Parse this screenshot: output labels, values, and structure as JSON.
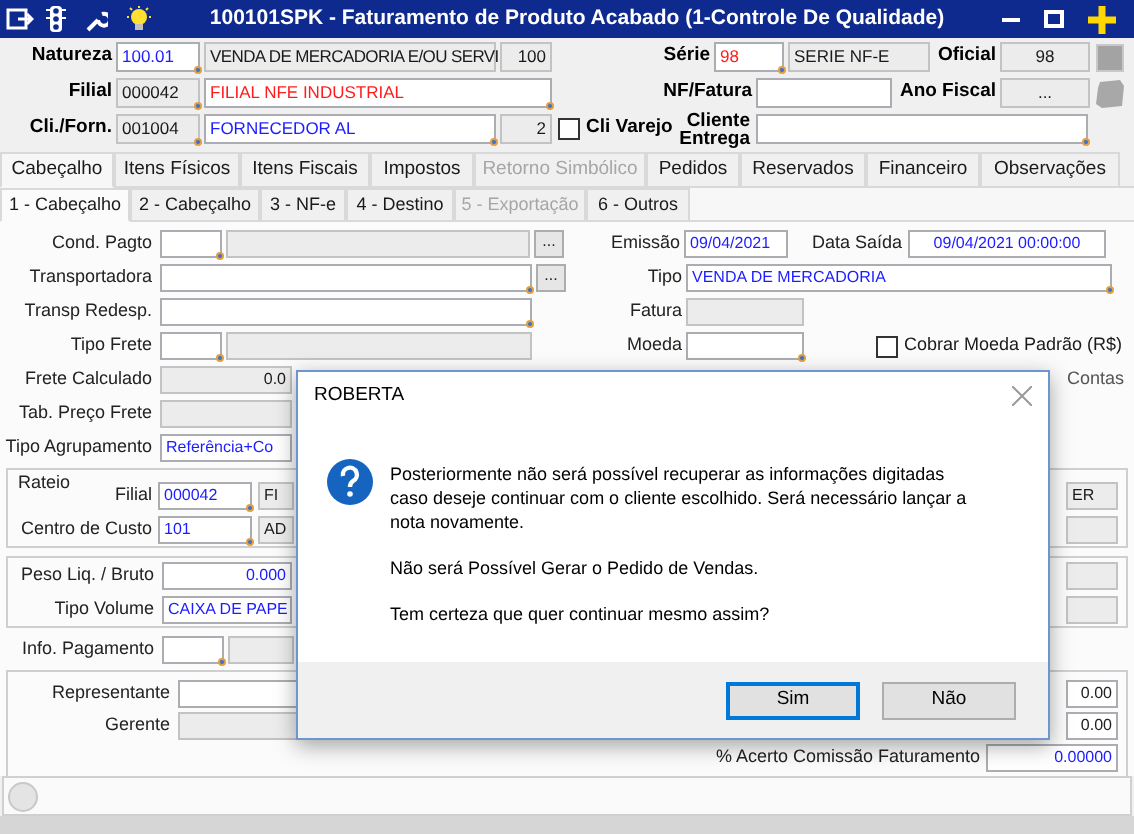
{
  "window": {
    "title": "100101SPK - Faturamento de Produto Acabado (1-Controle De Qualidade)"
  },
  "header": {
    "natureza": {
      "label": "Natureza",
      "code": "100.01",
      "description": "VENDA DE MERCADORIA E/OU SERVI",
      "number": "100"
    },
    "serie": {
      "label": "Série",
      "code": "98",
      "description": "SERIE NF-E"
    },
    "oficial": {
      "label": "Oficial",
      "value": "98"
    },
    "filial": {
      "label": "Filial",
      "code": "000042",
      "description": "FILIAL NFE INDUSTRIAL"
    },
    "nf_fatura": {
      "label": "NF/Fatura"
    },
    "ano_fiscal": {
      "label": "Ano Fiscal",
      "value": "..."
    },
    "cli_forn": {
      "label": "Cli./Forn.",
      "code": "001004",
      "description": "FORNECEDOR AL",
      "number": "2"
    },
    "cli_varejo": {
      "label": "Cli Varejo",
      "checked": false
    },
    "cliente_entrega": {
      "label": "Cliente Entrega"
    }
  },
  "tabs": [
    {
      "label": "Cabeçalho",
      "selected": true,
      "disabled": false
    },
    {
      "label": "Itens Físicos",
      "selected": false,
      "disabled": false
    },
    {
      "label": "Itens Fiscais",
      "selected": false,
      "disabled": false
    },
    {
      "label": "Impostos",
      "selected": false,
      "disabled": false
    },
    {
      "label": "Retorno Simbólico",
      "selected": false,
      "disabled": true
    },
    {
      "label": "Pedidos",
      "selected": false,
      "disabled": false
    },
    {
      "label": "Reservados",
      "selected": false,
      "disabled": false
    },
    {
      "label": "Financeiro",
      "selected": false,
      "disabled": false
    },
    {
      "label": "Observações",
      "selected": false,
      "disabled": false
    }
  ],
  "subtabs": [
    {
      "label": "1 - Cabeçalho",
      "selected": true,
      "disabled": false
    },
    {
      "label": "2 - Cabeçalho",
      "selected": false,
      "disabled": false
    },
    {
      "label": "3 - NF-e",
      "selected": false,
      "disabled": false
    },
    {
      "label": "4 - Destino",
      "selected": false,
      "disabled": false
    },
    {
      "label": "5 - Exportação",
      "selected": false,
      "disabled": true
    },
    {
      "label": "6 - Outros",
      "selected": false,
      "disabled": false
    }
  ],
  "form": {
    "cond_pagto": {
      "label": "Cond. Pagto",
      "button": "..."
    },
    "emissao": {
      "label": "Emissão",
      "value": "09/04/2021"
    },
    "data_saida": {
      "label": "Data Saída",
      "value": "09/04/2021 00:00:00"
    },
    "transportadora": {
      "label": "Transportadora",
      "button": "..."
    },
    "tipo": {
      "label": "Tipo",
      "value": "VENDA DE MERCADORIA"
    },
    "transp_redesp": {
      "label": "Transp Redesp."
    },
    "fatura": {
      "label": "Fatura"
    },
    "tipo_frete": {
      "label": "Tipo Frete"
    },
    "moeda": {
      "label": "Moeda"
    },
    "cobrar_moeda_padrao": {
      "label": "Cobrar Moeda Padrão (R$)",
      "checked": false
    },
    "frete_calculado": {
      "label": "Frete Calculado",
      "value": "0.0"
    },
    "contas": {
      "label": "Contas"
    },
    "tab_preco_frete": {
      "label": "Tab. Preço Frete"
    },
    "tipo_agrupamento": {
      "label": "Tipo Agrupamento",
      "value": "Referência+Co"
    },
    "rateio": {
      "title": "Rateio",
      "filial": {
        "label": "Filial",
        "code": "000042",
        "description": "FI",
        "column_3": "ER"
      },
      "centro_de_custo": {
        "label": "Centro de Custo",
        "code": "101",
        "description": "AD"
      }
    },
    "peso_liq_bruto": {
      "label": "Peso Liq. / Bruto",
      "value": "0.000"
    },
    "tipo_volume": {
      "label": "Tipo Volume",
      "value": "CAIXA DE PAPE"
    },
    "info_pagamento": {
      "label": "Info. Pagamento"
    },
    "representante": {
      "label": "Representante",
      "column_2": "0.00"
    },
    "gerente": {
      "label": "Gerente",
      "column_2": "0.00"
    },
    "acerto_comissao": {
      "label": "% Acerto Comissão Faturamento",
      "value": "0.00000"
    }
  },
  "dialog": {
    "title": "ROBERTA",
    "message": "Posteriormente não será possível recuperar as informações digitadas caso deseje continuar com o cliente escolhido. Será necessário lançar a nota novamente.",
    "note": "Não será Possível Gerar o Pedido de Vendas.",
    "question": "Tem certeza que quer continuar mesmo assim?",
    "buttons": [
      {
        "label": "Sim",
        "focused": true
      },
      {
        "label": "Não",
        "focused": false
      }
    ]
  }
}
